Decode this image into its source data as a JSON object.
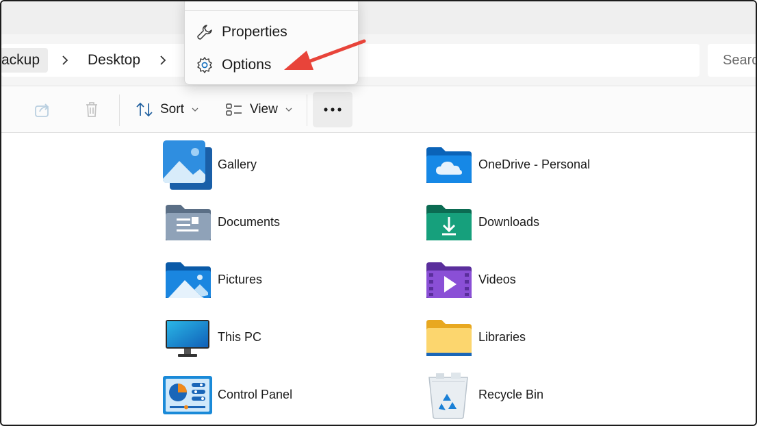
{
  "breadcrumb": {
    "items": [
      "ackup",
      "Desktop"
    ]
  },
  "search": {
    "placeholder": "Search"
  },
  "toolbar": {
    "sort_label": "Sort",
    "view_label": "View"
  },
  "context_menu": {
    "items": [
      "Properties",
      "Options"
    ]
  },
  "desktop_items": [
    "Gallery",
    "OneDrive - Personal",
    "Documents",
    "Downloads",
    "Pictures",
    "Videos",
    "This PC",
    "Libraries",
    "Control Panel",
    "Recycle Bin"
  ],
  "annotation": {
    "arrow_color": "#e8443a",
    "target": "Options"
  },
  "colors": {
    "accent": "#0f6cbd",
    "arrow": "#e8443a"
  }
}
